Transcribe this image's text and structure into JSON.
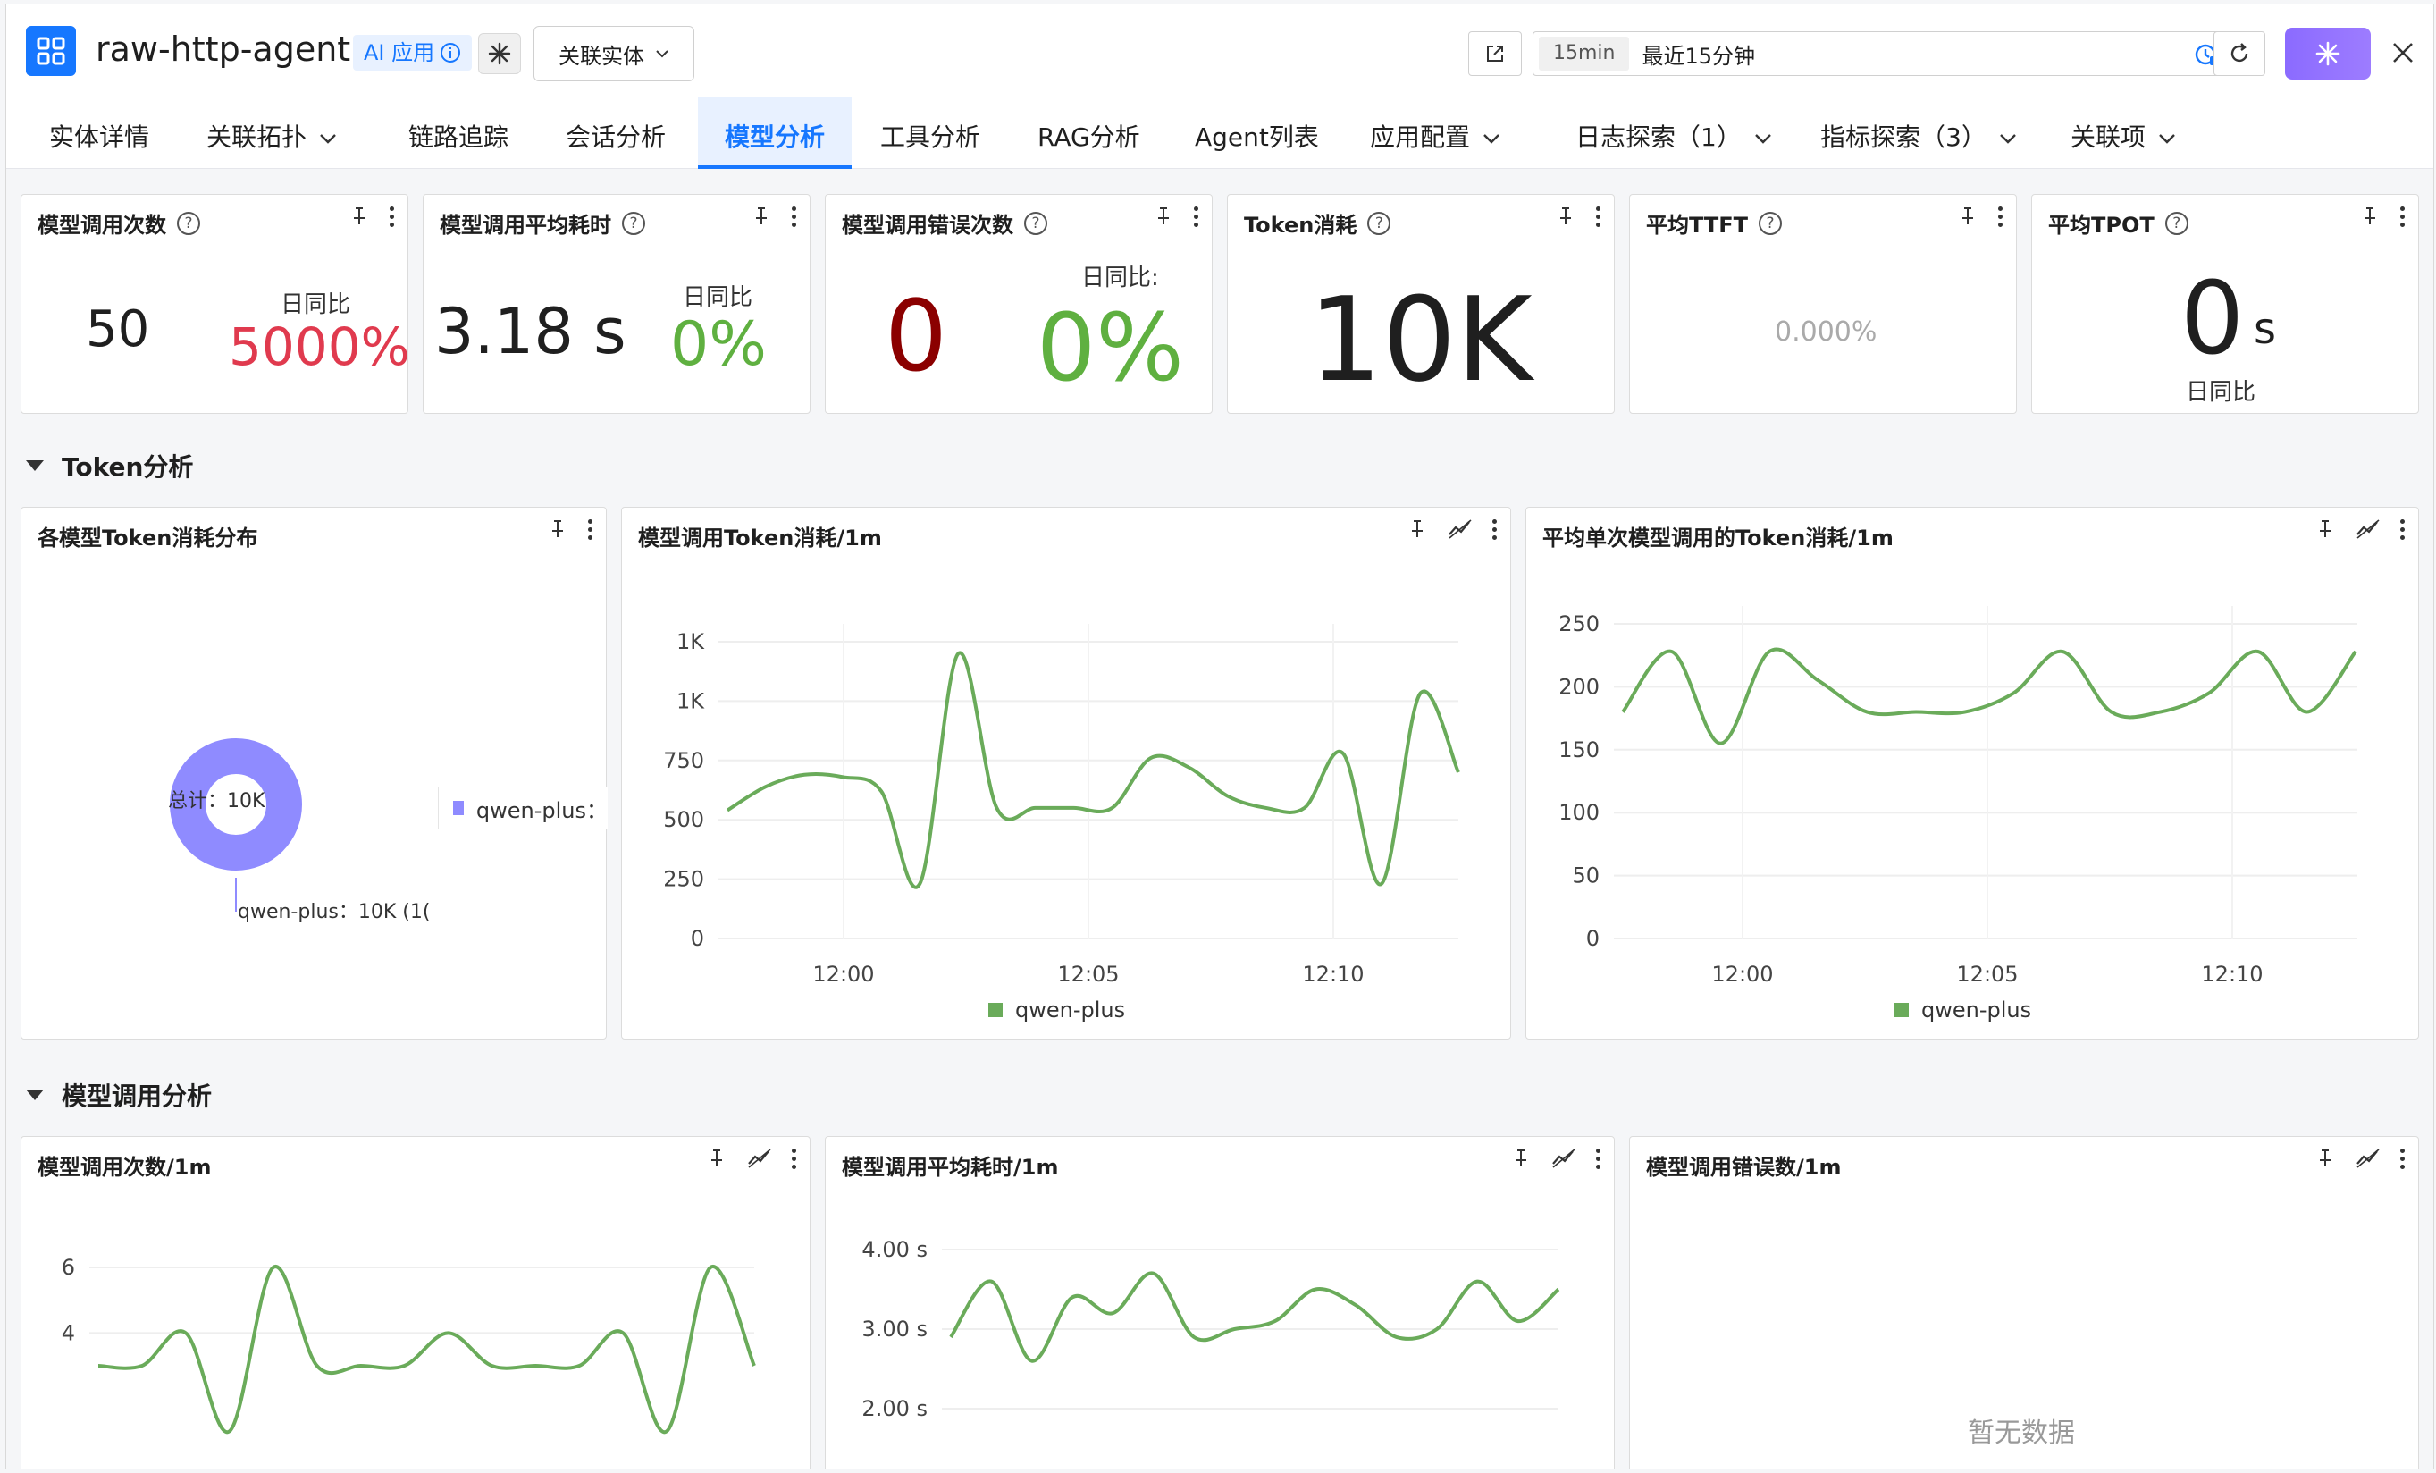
{
  "header": {
    "app_title": "raw-http-agent",
    "ai_tag": "AI 应用",
    "related_entity": "关联实体",
    "time_chip": "15min",
    "time_text": "最近15分钟"
  },
  "tabs": [
    "实体详情",
    "关联拓扑",
    "链路追踪",
    "会话分析",
    "模型分析",
    "工具分析",
    "RAG分析",
    "Agent列表",
    "应用配置",
    "日志探索（1）",
    "指标探索（3）",
    "关联项"
  ],
  "active_tab": "模型分析",
  "stats": [
    {
      "title": "模型调用次数",
      "value": "50",
      "cmp_label": "日同比",
      "cmp_value": "5000%",
      "cmp_color": "#e03a4e"
    },
    {
      "title": "模型调用平均耗时",
      "value": "3.18 s",
      "cmp_label": "日同比",
      "cmp_value": "0%",
      "cmp_color": "#5fb040"
    },
    {
      "title": "模型调用错误次数",
      "value": "0",
      "value_color": "#8b0000",
      "cmp_label": "日同比:",
      "cmp_value": "0%",
      "cmp_color": "#5fb040"
    },
    {
      "title": "Token消耗",
      "value": "10K"
    },
    {
      "title": "平均TTFT",
      "value": "0.000%"
    },
    {
      "title": "平均TPOT",
      "value": "0",
      "unit": "s",
      "cmp_label": "日同比"
    }
  ],
  "sections": {
    "token": "Token分析",
    "model": "模型调用分析"
  },
  "donut": {
    "title": "各模型Token消耗分布",
    "center_label": "总计：10K",
    "legend": "qwen-plus：",
    "slice_label": "qwen-plus：10K (1(",
    "color": "#8f8bff"
  },
  "charts": {
    "token_per_min": {
      "title": "模型调用Token消耗/1m",
      "yticks": [
        "1K",
        "1K",
        "750",
        "500",
        "250",
        "0"
      ],
      "xticks": [
        "12:00",
        "12:05",
        "12:10"
      ],
      "legend": "qwen-plus"
    },
    "avg_token": {
      "title": "平均单次模型调用的Token消耗/1m",
      "yticks": [
        "250",
        "200",
        "150",
        "100",
        "50",
        "0"
      ],
      "xticks": [
        "12:00",
        "12:05",
        "12:10"
      ],
      "legend": "qwen-plus"
    },
    "calls_per_min": {
      "title": "模型调用次数/1m",
      "yticks": [
        "6",
        "4"
      ]
    },
    "avg_latency": {
      "title": "模型调用平均耗时/1m",
      "yticks": [
        "4.00 s",
        "3.00 s",
        "2.00 s"
      ]
    },
    "errors": {
      "title": "模型调用错误数/1m",
      "empty_text": "暂无数据"
    }
  },
  "chart_data": [
    {
      "type": "line",
      "title": "模型调用Token消耗/1m",
      "series": [
        {
          "name": "qwen-plus",
          "values": [
            540,
            640,
            690,
            680,
            620,
            230,
            1200,
            550,
            550,
            550,
            550,
            760,
            720,
            600,
            550,
            550,
            780,
            230,
            1030,
            700
          ]
        }
      ],
      "ylim": [
        0,
        1300
      ],
      "color": "#6aab5a"
    },
    {
      "type": "line",
      "title": "平均单次模型调用的Token消耗/1m",
      "series": [
        {
          "name": "qwen-plus",
          "values": [
            180,
            228,
            155,
            228,
            205,
            180,
            180,
            180,
            195,
            228,
            180,
            180,
            195,
            228,
            180,
            228
          ]
        }
      ],
      "ylim": [
        0,
        250
      ],
      "color": "#6aab5a"
    },
    {
      "type": "line",
      "title": "模型调用次数/1m",
      "series": [
        {
          "values": [
            3,
            3,
            4,
            1,
            6,
            3,
            3,
            3,
            4,
            3,
            3,
            3,
            4,
            1,
            6,
            3
          ]
        }
      ],
      "color": "#6aab5a"
    },
    {
      "type": "line",
      "title": "模型调用平均耗时/1m",
      "series": [
        {
          "values": [
            2.9,
            3.6,
            2.6,
            3.4,
            3.2,
            3.7,
            2.9,
            3.0,
            3.1,
            3.5,
            3.3,
            2.9,
            3.0,
            3.6,
            3.1,
            3.5
          ]
        }
      ],
      "color": "#6aab5a"
    }
  ]
}
